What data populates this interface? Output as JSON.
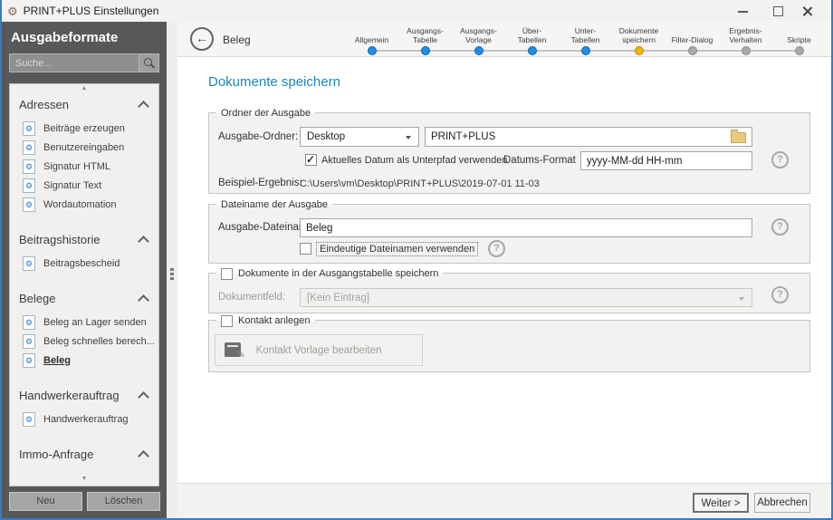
{
  "window": {
    "title": "PRINT+PLUS Einstellungen"
  },
  "colors": {
    "accent_heading": "#1d86ba",
    "window_border": "#3a7bbf",
    "step_done": {
      "fill": "#1f8ceb",
      "border": "#1064ad"
    },
    "step_current": {
      "fill": "#edb800",
      "border": "#b78e12"
    },
    "step_todo": {
      "fill": "#a9a9a9",
      "border": "#8c8c8c"
    }
  },
  "sidebar": {
    "title": "Ausgabeformate",
    "search_placeholder": "Suche...",
    "sections": [
      {
        "label": "Adressen",
        "items": [
          {
            "label": "Beiträge erzeugen"
          },
          {
            "label": "Benutzereingaben"
          },
          {
            "label": "Signatur HTML"
          },
          {
            "label": "Signatur Text"
          },
          {
            "label": "Wordautomation"
          }
        ]
      },
      {
        "label": "Beitragshistorie",
        "items": [
          {
            "label": "Beitragsbescheid"
          }
        ]
      },
      {
        "label": "Belege",
        "items": [
          {
            "label": "Beleg an Lager senden"
          },
          {
            "label": "Beleg schnelles berech..."
          },
          {
            "label": "Beleg",
            "selected": true
          }
        ]
      },
      {
        "label": "Handwerkerauftrag",
        "items": [
          {
            "label": "Handwerkerauftrag"
          }
        ]
      },
      {
        "label": "Immo-Anfrage",
        "items": []
      }
    ],
    "buttons": {
      "new": "Neu",
      "delete": "Löschen"
    }
  },
  "header": {
    "back_label": "Beleg",
    "steps": [
      {
        "l1": "Allgemein",
        "l2": "",
        "state": "done"
      },
      {
        "l1": "Ausgangs-",
        "l2": "Tabelle",
        "state": "done"
      },
      {
        "l1": "Ausgangs-",
        "l2": "Vorlage",
        "state": "done"
      },
      {
        "l1": "Über-",
        "l2": "Tabellen",
        "state": "done"
      },
      {
        "l1": "Unter-",
        "l2": "Tabellen",
        "state": "done"
      },
      {
        "l1": "Dokumente",
        "l2": "speichern",
        "state": "current"
      },
      {
        "l1": "Filter-Dialog",
        "l2": "",
        "state": "todo"
      },
      {
        "l1": "Ergebnis-",
        "l2": "Verhalten",
        "state": "todo"
      },
      {
        "l1": "Skripte",
        "l2": "",
        "state": "todo"
      }
    ]
  },
  "page": {
    "title": "Dokumente speichern"
  },
  "groups": {
    "output_folder": {
      "legend": "Ordner der Ausgabe",
      "folder_label": "Ausgabe-Ordner:",
      "folder_select_value": "Desktop",
      "folder_path_value": "PRINT+PLUS",
      "date_checkbox_label": "Aktuelles Datum als Unterpfad verwenden",
      "date_checkbox_checked": true,
      "date_format_label": "Datums-Format",
      "date_format_value": "yyyy-MM-dd HH-mm",
      "example_label": "Beispiel-Ergebnis:",
      "example_value": "C:\\Users\\vm\\Desktop\\PRINT+PLUS\\2019-07-01 11-03"
    },
    "output_filename": {
      "legend": "Dateiname der Ausgabe",
      "filename_label": "Ausgabe-Dateiname:",
      "filename_value": "Beleg",
      "unique_checkbox_label": "Eindeutige Dateinamen verwenden",
      "unique_checkbox_checked": false
    },
    "save_in_table": {
      "legend": "Dokumente in der Ausgangstabelle speichern",
      "legend_checkbox_checked": false,
      "field_label": "Dokumentfeld:",
      "field_value": "[Kein Eintrag]"
    },
    "create_contact": {
      "legend": "Kontakt anlegen",
      "legend_checkbox_checked": false,
      "button_label": "Kontakt Vorlage bearbeiten"
    }
  },
  "footer": {
    "next": "Weiter >",
    "cancel": "Abbrechen"
  }
}
